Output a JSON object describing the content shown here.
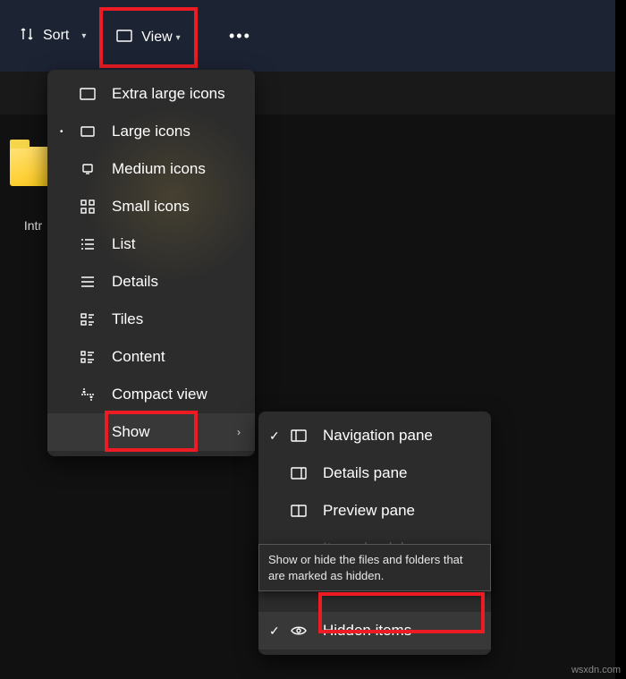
{
  "toolbar": {
    "sort_label": "Sort",
    "view_label": "View",
    "more_label": "…"
  },
  "folder": {
    "name": "Intr"
  },
  "view_menu": {
    "items": [
      {
        "label": "Extra large icons"
      },
      {
        "label": "Large icons",
        "selected": true
      },
      {
        "label": "Medium icons"
      },
      {
        "label": "Small icons"
      },
      {
        "label": "List"
      },
      {
        "label": "Details"
      },
      {
        "label": "Tiles"
      },
      {
        "label": "Content"
      },
      {
        "label": "Compact view"
      },
      {
        "label": "Show",
        "submenu": true
      }
    ]
  },
  "show_menu": {
    "items": [
      {
        "label": "Navigation pane",
        "checked": true
      },
      {
        "label": "Details pane"
      },
      {
        "label": "Preview pane"
      },
      {
        "label": "Item check boxes"
      },
      {
        "label": "Hidden items",
        "checked": true
      }
    ]
  },
  "tooltip": "Show or hide the files and folders that are marked as hidden.",
  "watermark": "wsxdn.com"
}
